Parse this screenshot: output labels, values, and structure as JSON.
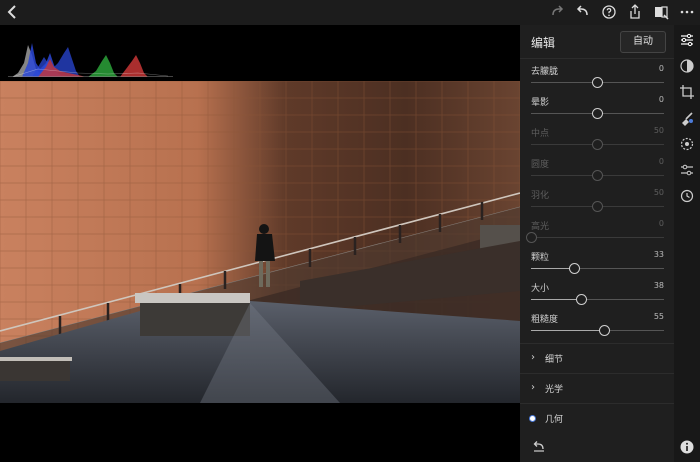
{
  "topbar": {
    "back_icon": "chevron-left-icon",
    "redo_icon": "redo-icon",
    "undo_icon": "undo-icon",
    "help_icon": "help-icon",
    "share_icon": "share-icon",
    "compare_icon": "compare-icon",
    "more_icon": "more-icon"
  },
  "panel": {
    "title": "编辑",
    "auto_label": "自动",
    "sliders": [
      {
        "label": "去朦胧",
        "value": "0",
        "level": 0.5,
        "enabled": true
      },
      {
        "label": "晕影",
        "value": "0",
        "level": 0.5,
        "enabled": true
      },
      {
        "label": "中点",
        "value": "50",
        "level": 0.5,
        "enabled": false
      },
      {
        "label": "圆度",
        "value": "0",
        "level": 0.5,
        "enabled": false
      },
      {
        "label": "羽化",
        "value": "50",
        "level": 0.5,
        "enabled": false
      },
      {
        "label": "高光",
        "value": "0",
        "level": 0.0,
        "enabled": false
      },
      {
        "label": "颗粒",
        "value": "33",
        "level": 0.33,
        "enabled": true
      },
      {
        "label": "大小",
        "value": "38",
        "level": 0.38,
        "enabled": true
      },
      {
        "label": "粗糙度",
        "value": "55",
        "level": 0.55,
        "enabled": true
      }
    ],
    "sections": [
      {
        "label": "细节",
        "icon": "chevron-right-icon"
      },
      {
        "label": "光学",
        "icon": "chevron-right-icon"
      },
      {
        "label": "几何",
        "icon": "radio-selected-icon"
      }
    ],
    "reset_icon": "reset-icon"
  },
  "tools": [
    "sliders-icon",
    "color-icon",
    "crop-icon",
    "brush-icon",
    "selective-icon",
    "presets-icon",
    "history-icon",
    "info-icon"
  ]
}
